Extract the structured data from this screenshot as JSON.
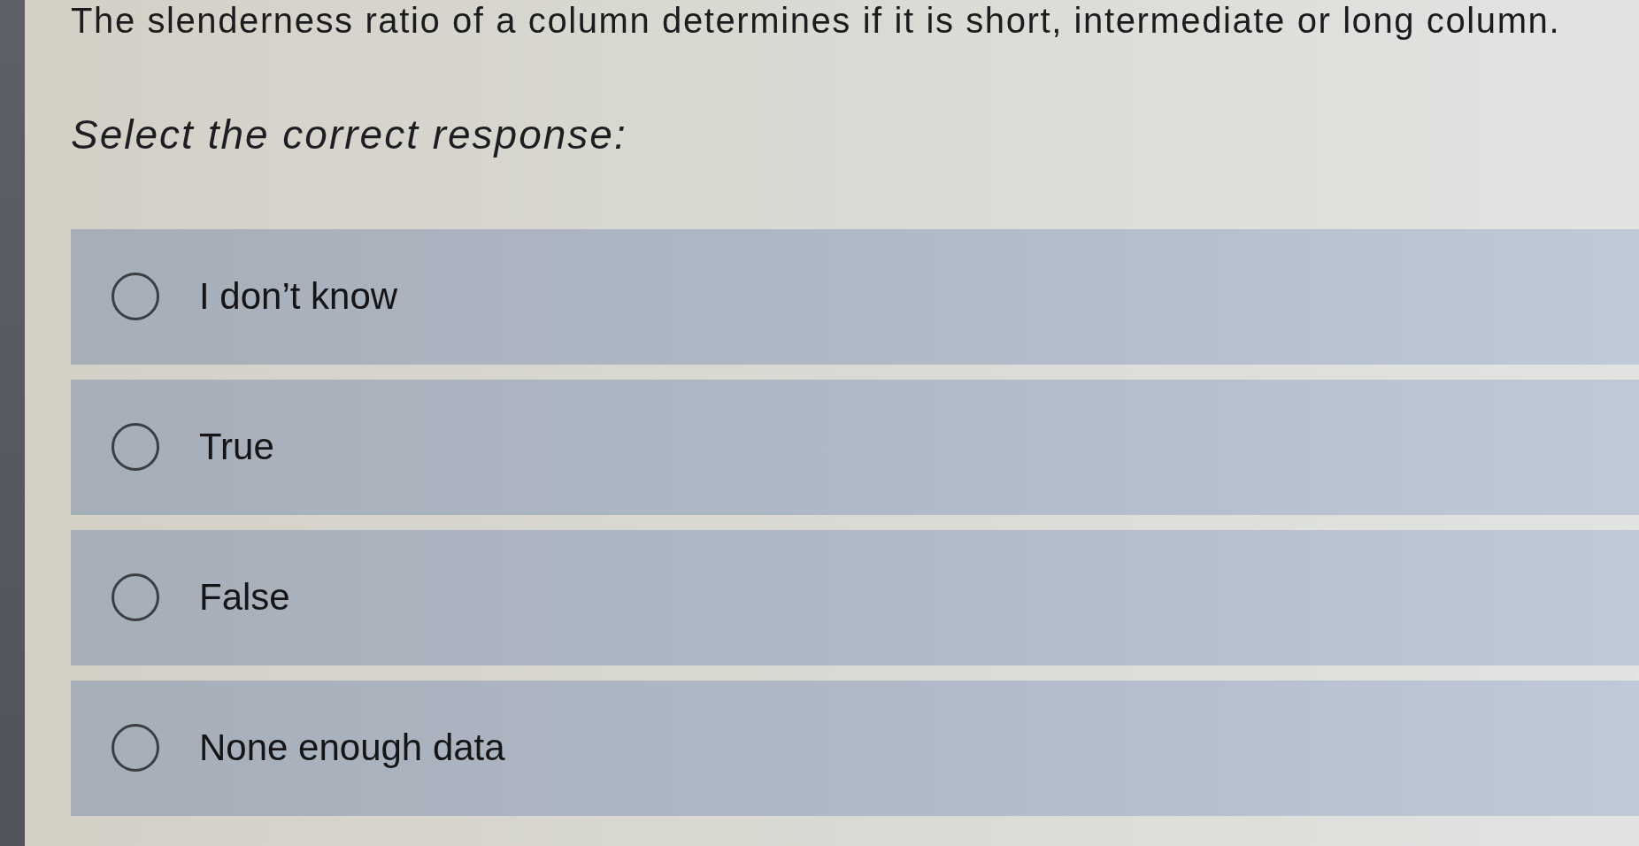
{
  "question": {
    "text": "The slenderness ratio of a column determines if it is short, intermediate or long column."
  },
  "instruction": "Select the correct response:",
  "options": [
    {
      "label": "I don’t know",
      "selected": false
    },
    {
      "label": "True",
      "selected": false
    },
    {
      "label": "False",
      "selected": false
    },
    {
      "label": "None enough data",
      "selected": false
    }
  ]
}
